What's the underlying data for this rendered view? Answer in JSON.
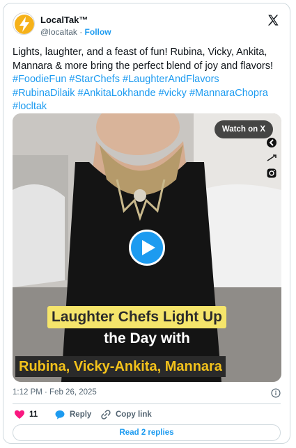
{
  "author": {
    "name": "LocalTak™",
    "handle": "@localtak",
    "separator": " · ",
    "follow_label": "Follow",
    "avatar_icon": "lightning-bolt-logo"
  },
  "tweet": {
    "text_plain": "Lights, laughter, and a feast of fun! Rubina, Vicky, Ankita, Mannara & more bring the perfect blend of joy and flavors!  ",
    "hashtags": [
      "#FoodieFun",
      "#StarChefs",
      "#LaughterAndFlavors",
      "#RubinaDilaik",
      "#AnkitaLokhande",
      "#vicky",
      "#MannaraChopra",
      "#locltak"
    ]
  },
  "media": {
    "watch_label": "Watch on X",
    "captions": {
      "line1": "Laughter Chefs Light Up",
      "line2": "the Day with",
      "line3": "Rubina, Vicky-Ankita, Mannara"
    },
    "play_icon": "play-icon"
  },
  "meta": {
    "timestamp": "1:12 PM · Feb 26, 2025"
  },
  "actions": {
    "like_count": "11",
    "reply_label": "Reply",
    "copy_label": "Copy link"
  },
  "read_replies_label": "Read 2 replies",
  "colors": {
    "accent": "#1d9bf0",
    "like": "#f91880",
    "caption_highlight": "#f5e56b",
    "caption_gold": "#f3c21b"
  }
}
